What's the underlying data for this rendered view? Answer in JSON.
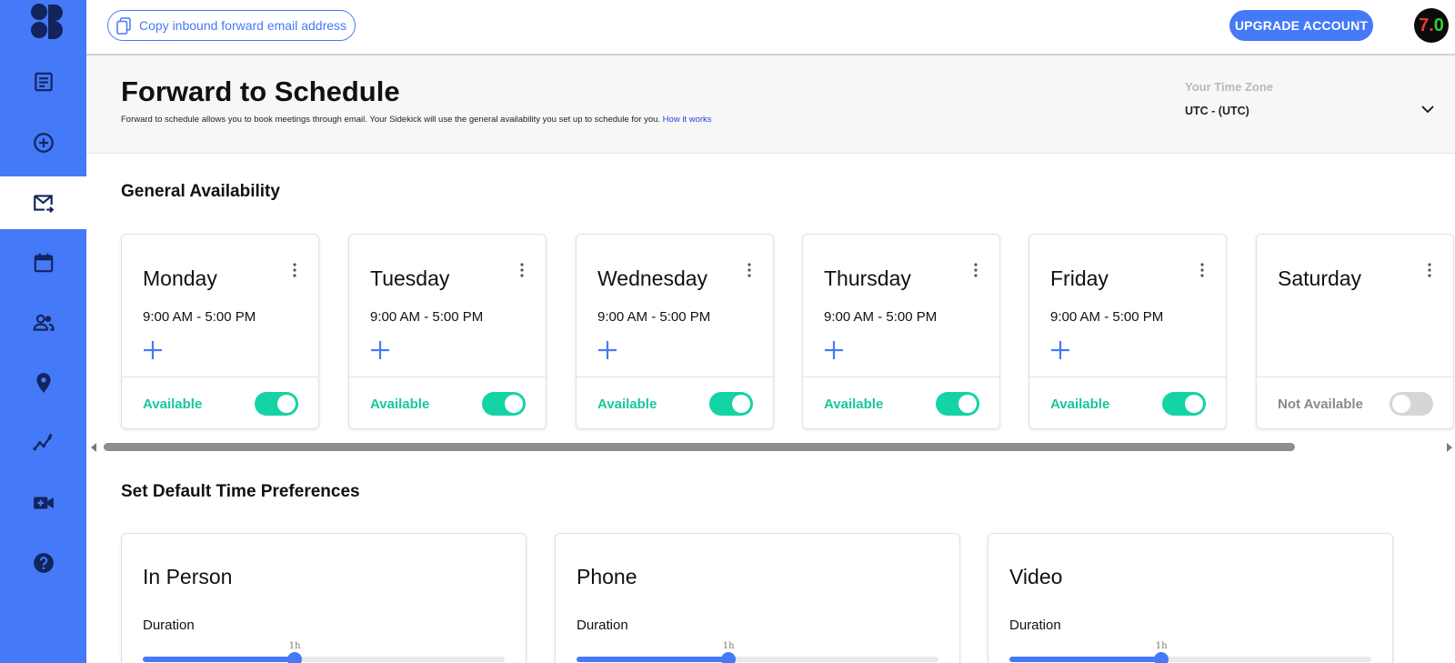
{
  "topbar": {
    "copy_label": "Copy inbound forward email address",
    "upgrade_label": "UPGRADE ACCOUNT",
    "avatar_text": "7.0",
    "avatar_text_main": "7.",
    "avatar_text_accent": "0"
  },
  "sidebar": {
    "items": [
      {
        "icon": "notes-icon"
      },
      {
        "icon": "add-circle-icon"
      },
      {
        "icon": "forward-email-icon",
        "active": true
      },
      {
        "icon": "calendar-icon"
      },
      {
        "icon": "contacts-icon"
      },
      {
        "icon": "location-pin-icon"
      },
      {
        "icon": "insights-icon"
      },
      {
        "icon": "video-add-icon"
      },
      {
        "icon": "help-icon"
      }
    ]
  },
  "header": {
    "title": "Forward to Schedule",
    "description": "Forward to schedule allows you to book meetings through email. Your Sidekick will use the general availability you set up to schedule for you.",
    "how_link": "How it works",
    "timezone_label": "Your Time Zone",
    "timezone_value": "UTC - (UTC)"
  },
  "availability": {
    "title": "General Availability",
    "days": [
      {
        "name": "Monday",
        "hours": "9:00 AM - 5:00 PM",
        "status": "Available",
        "enabled": true
      },
      {
        "name": "Tuesday",
        "hours": "9:00 AM - 5:00 PM",
        "status": "Available",
        "enabled": true
      },
      {
        "name": "Wednesday",
        "hours": "9:00 AM - 5:00 PM",
        "status": "Available",
        "enabled": true
      },
      {
        "name": "Thursday",
        "hours": "9:00 AM - 5:00 PM",
        "status": "Available",
        "enabled": true
      },
      {
        "name": "Friday",
        "hours": "9:00 AM - 5:00 PM",
        "status": "Available",
        "enabled": true
      },
      {
        "name": "Saturday",
        "hours": "",
        "status": "Not Available",
        "enabled": false
      }
    ]
  },
  "preferences": {
    "title": "Set Default Time Preferences",
    "items": [
      {
        "name": "In Person",
        "duration_label": "Duration",
        "slider_value": "1h",
        "slider_percent": 42
      },
      {
        "name": "Phone",
        "duration_label": "Duration",
        "slider_value": "1h",
        "slider_percent": 42
      },
      {
        "name": "Video",
        "duration_label": "Duration",
        "slider_value": "1h",
        "slider_percent": 42
      }
    ]
  },
  "colors": {
    "brand": "#4479f7",
    "available": "#18c79a",
    "toggle_on": "#14d3a5",
    "toggle_off": "#d6d6d6"
  }
}
